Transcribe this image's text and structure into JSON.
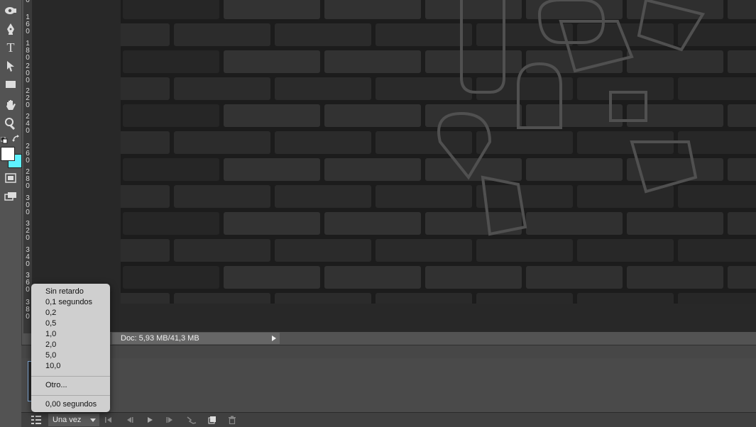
{
  "app": {
    "accent": "#8ab4e4",
    "foreground_color": "#ffffff",
    "background_color": "#5ef2ff"
  },
  "toolbar": {
    "tools": [
      {
        "name": "crop-eye-icon"
      },
      {
        "name": "pen-icon"
      },
      {
        "name": "type-icon",
        "glyph": "T"
      },
      {
        "name": "path-selection-icon"
      },
      {
        "name": "rectangle-icon"
      },
      {
        "name": "hand-icon"
      },
      {
        "name": "zoom-icon"
      },
      {
        "name": "quick-mask-icon"
      },
      {
        "name": "screen-mode-icon"
      }
    ]
  },
  "ruler": {
    "groups": [
      [
        "0"
      ],
      [
        "1",
        "6",
        "0"
      ],
      [
        "1",
        "8",
        "0"
      ],
      [
        "2",
        "0",
        "0"
      ],
      [
        "2",
        "2",
        "0"
      ],
      [
        "2",
        "4",
        "0"
      ],
      [
        "2",
        "6",
        "0"
      ],
      [
        "2",
        "8",
        "0"
      ],
      [
        "3",
        "0",
        "0"
      ],
      [
        "3",
        "2",
        "0"
      ],
      [
        "3",
        "4",
        "0"
      ],
      [
        "3",
        "6",
        "0"
      ],
      [
        "3",
        "8",
        "0"
      ]
    ]
  },
  "status": {
    "doc_info": "Doc: 5,93 MB/41,3 MB"
  },
  "timeline": {
    "loop_option": "Una vez"
  },
  "delay_menu": {
    "items": [
      "Sin retardo",
      "0,1 segundos",
      "0,2",
      "0,5",
      "1,0",
      "2,0",
      "5,0",
      "10,0"
    ],
    "other": "Otro...",
    "current": "0,00 segundos"
  }
}
